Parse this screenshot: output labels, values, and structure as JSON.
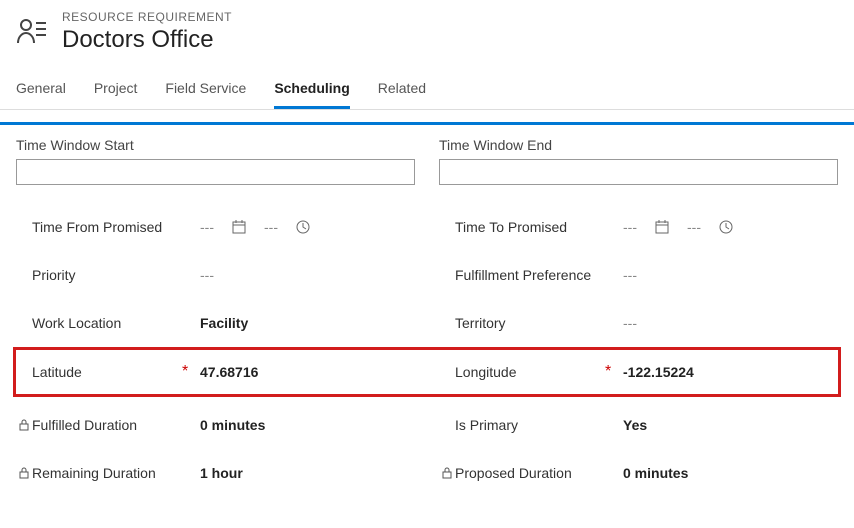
{
  "header": {
    "subtitle": "RESOURCE REQUIREMENT",
    "title": "Doctors Office"
  },
  "tabs": {
    "general": "General",
    "project": "Project",
    "field_service": "Field Service",
    "scheduling": "Scheduling",
    "related": "Related"
  },
  "left": {
    "section_label": "Time Window Start",
    "time_from_promised_label": "Time From Promised",
    "time_from_promised_value": "---",
    "priority_label": "Priority",
    "priority_value": "---",
    "work_location_label": "Work Location",
    "work_location_value": "Facility",
    "latitude_label": "Latitude",
    "latitude_value": "47.68716",
    "fulfilled_duration_label": "Fulfilled Duration",
    "fulfilled_duration_value": "0 minutes",
    "remaining_duration_label": "Remaining Duration",
    "remaining_duration_value": "1 hour"
  },
  "right": {
    "section_label": "Time Window End",
    "time_to_promised_label": "Time To Promised",
    "time_to_promised_value": "---",
    "fulfillment_pref_label": "Fulfillment Preference",
    "fulfillment_pref_value": "---",
    "territory_label": "Territory",
    "territory_value": "---",
    "longitude_label": "Longitude",
    "longitude_value": "-122.15224",
    "is_primary_label": "Is Primary",
    "is_primary_value": "Yes",
    "proposed_duration_label": "Proposed Duration",
    "proposed_duration_value": "0 minutes"
  },
  "glyphs": {
    "dash": "---",
    "required": "*"
  }
}
